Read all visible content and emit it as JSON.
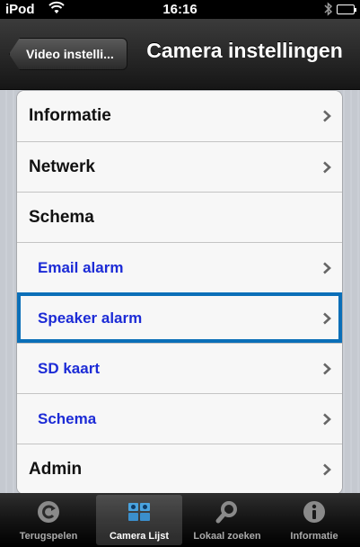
{
  "status_bar": {
    "carrier": "iPod",
    "time": "16:16",
    "bluetooth_icon": "bluetooth-icon",
    "wifi_icon": "wifi-icon",
    "battery_icon": "battery-icon"
  },
  "nav_bar": {
    "back_label": "Video instelli...",
    "title": "Camera instellingen"
  },
  "settings": {
    "items": [
      {
        "label": "Informatie",
        "has_chevron": true
      },
      {
        "label": "Netwerk",
        "has_chevron": true
      },
      {
        "label": "Schema",
        "has_chevron": false
      },
      {
        "label": "Email alarm",
        "has_chevron": true,
        "sub": true
      },
      {
        "label": "Speaker alarm",
        "has_chevron": true,
        "sub": true,
        "highlighted": true
      },
      {
        "label": "SD kaart",
        "has_chevron": true,
        "sub": true
      },
      {
        "label": "Schema",
        "has_chevron": true,
        "sub": true
      },
      {
        "label": "Admin",
        "has_chevron": true
      }
    ]
  },
  "tab_bar": {
    "tabs": [
      {
        "label": "Terugspelen",
        "icon": "replay-icon",
        "selected": false
      },
      {
        "label": "Camera Lijst",
        "icon": "camera-list-icon",
        "selected": true
      },
      {
        "label": "Lokaal zoeken",
        "icon": "search-icon",
        "selected": false
      },
      {
        "label": "Informatie",
        "icon": "info-icon",
        "selected": false
      }
    ]
  },
  "colors": {
    "sub_item_text": "#1c2bd6",
    "highlight_border": "#0b6fb8"
  }
}
